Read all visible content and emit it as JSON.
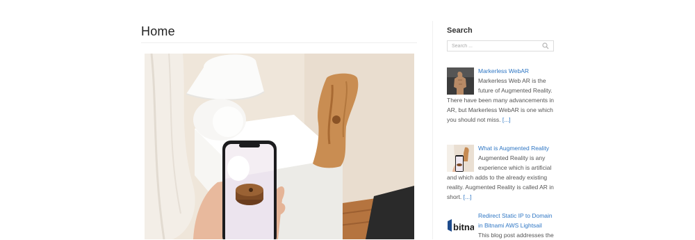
{
  "top_fragment": "",
  "main": {
    "title": "Home",
    "featured_image": "photo-hand-holding-phone-ar-wood-sculpture"
  },
  "sidebar": {
    "search": {
      "title": "Search",
      "placeholder": "Search ...",
      "icon": "search-icon"
    },
    "posts": [
      {
        "title": "Markerless WebAR",
        "excerpt": "Markerless Web AR is the future of Augmented Reality. There have been many advancements in AR, but Markerless WebAR is one which you should not miss.",
        "read_more": "[...]",
        "thumbnail": "thumb-figure-sculpture"
      },
      {
        "title": "What is Augmented Reality",
        "excerpt": "Augmented Reality is any experience which is artificial and which adds to the already existing reality. Augmented Reality is called AR in short.",
        "read_more": "[...]",
        "thumbnail": "thumb-phone-ar"
      },
      {
        "title": "Redirect Static IP to Domain in Bitnami AWS Lightsail",
        "excerpt": "This blog post addresses the",
        "thumbnail": "thumb-bitnami-logo",
        "thumb_text": "bitna"
      }
    ]
  },
  "colors": {
    "link": "#2e76c4",
    "text": "#555555",
    "heading": "#222222"
  }
}
